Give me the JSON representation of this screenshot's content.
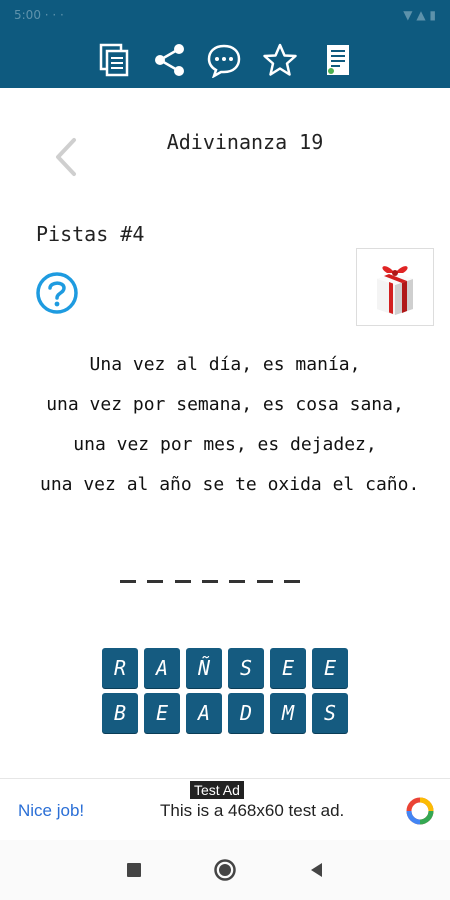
{
  "app": {
    "title": "Adivinanza 19",
    "hints_label": "Pistas #4"
  },
  "statusbar": {
    "left_text": "5:00 · · ·",
    "right_text": "▼ ▲ ▮"
  },
  "toolbar": {
    "icons": [
      "copy-icon",
      "share-icon",
      "chat-icon",
      "star-icon",
      "list-icon"
    ],
    "color": "#0e5a7f"
  },
  "riddle": {
    "lines": [
      "Una vez al día, es manía,",
      "una vez por semana, es cosa sana,",
      "una vez por mes, es dejadez,",
      "una vez al año se te oxida el caño."
    ]
  },
  "answer": {
    "slots": 7
  },
  "letters": {
    "row1": [
      "R",
      "A",
      "Ñ",
      "S",
      "E",
      "E"
    ],
    "row2": [
      "B",
      "E",
      "A",
      "D",
      "M",
      "S"
    ]
  },
  "ad": {
    "label": "Test Ad",
    "nice": "Nice job!",
    "text": "This is a 468x60 test ad."
  },
  "nav": {
    "icons": [
      "square-icon",
      "circle-icon",
      "back-triangle-icon"
    ]
  }
}
